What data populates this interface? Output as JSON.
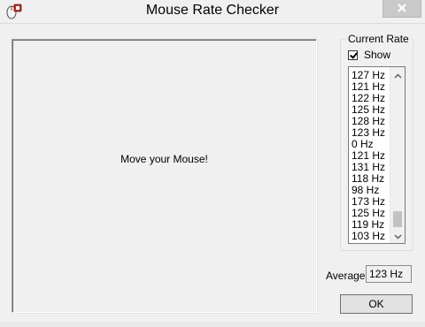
{
  "window": {
    "title": "Mouse Rate Checker",
    "close_icon": "close-icon",
    "app_icon": "mouse-app-icon"
  },
  "move_area": {
    "label": "Move your Mouse!"
  },
  "current_rate": {
    "group_label": "Current Rate",
    "show_label": "Show",
    "show_checked": true,
    "rates": [
      "127 Hz",
      "121 Hz",
      "122 Hz",
      "125 Hz",
      "128 Hz",
      "123 Hz",
      "0 Hz",
      "121 Hz",
      "131 Hz",
      "118 Hz",
      "98 Hz",
      "173 Hz",
      "125 Hz",
      "119 Hz",
      "103 Hz"
    ]
  },
  "average": {
    "label": "Average",
    "value": "123 Hz"
  },
  "buttons": {
    "ok_label": "OK"
  }
}
